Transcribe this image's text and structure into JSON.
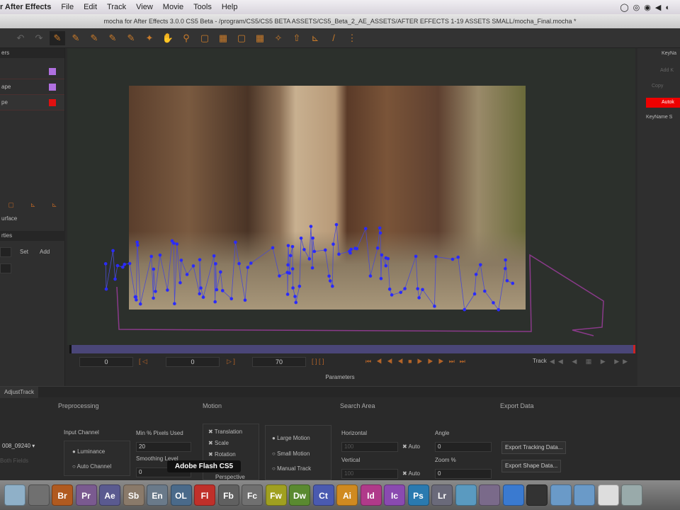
{
  "menubar": {
    "app": "r After Effects",
    "items": [
      "File",
      "Edit",
      "Track",
      "View",
      "Movie",
      "Tools",
      "Help"
    ]
  },
  "window": {
    "title": "mocha for After Effects 3.0.0 CS5 Beta - /program/CS5/CS5 BETA ASSETS/CS5_Beta_2_AE_ASSETS/AFTER EFFECTS 1-19 ASSETS SMALL/mocha_Final.mocha *"
  },
  "layers": {
    "header": "ers",
    "items": [
      {
        "label": "",
        "color": "#b070e0"
      },
      {
        "label": "ape",
        "color": "#b070e0"
      },
      {
        "label": "pe",
        "color": "#e01010"
      }
    ],
    "surface": "urface"
  },
  "clip_panel": {
    "header": "rties",
    "set": "Set",
    "add": "Add"
  },
  "right_panel": {
    "keyframe": "KeyNa",
    "add_key": "Add K",
    "copy": "Copy",
    "auto": "Autok",
    "keyname": "KeyName S"
  },
  "transport": {
    "in": "0",
    "current": "0",
    "out": "70",
    "track_label": "Track"
  },
  "parameters_label": "Parameters",
  "tab": "AdjustTrack",
  "sections": {
    "preprocessing": "Preprocessing",
    "motion": "Motion",
    "search": "Search Area",
    "export": "Export Data"
  },
  "preprocessing": {
    "clip": "008_09240",
    "clip_sub": "Both Fields",
    "input_channel": "Input Channel",
    "luminance": "Luminance",
    "auto_channel": "Auto Channel",
    "min_pixels": "Min % Pixels Used",
    "min_pixels_value": "20",
    "smoothing": "Smoothing Level",
    "smoothing_value": "0"
  },
  "motion": {
    "translation": "Translation",
    "scale": "Scale",
    "rotation": "Rotation",
    "perspective": "Perspective",
    "large": "Large Motion",
    "small": "Small Motion",
    "manual": "Manual Track"
  },
  "search": {
    "horizontal": "Horizontal",
    "h_value": "100",
    "vertical": "Vertical",
    "v_value": "100",
    "auto": "Auto",
    "angle": "Angle",
    "angle_value": "0",
    "zoom": "Zoom %",
    "zoom_value": "0"
  },
  "export": {
    "tracking": "Export Tracking Data...",
    "shape": "Export Shape Data..."
  },
  "tooltip": "Adobe Flash CS5",
  "dock": [
    {
      "label": "",
      "color": "#8fb0c8"
    },
    {
      "label": "",
      "color": "#707070"
    },
    {
      "label": "Br",
      "color": "#b05a20"
    },
    {
      "label": "Pr",
      "color": "#7a5a90"
    },
    {
      "label": "Ae",
      "color": "#5a5a90"
    },
    {
      "label": "Sb",
      "color": "#8a7a6a"
    },
    {
      "label": "En",
      "color": "#6a7a8a"
    },
    {
      "label": "OL",
      "color": "#4a6a8a"
    },
    {
      "label": "Fl",
      "color": "#c0302a"
    },
    {
      "label": "Fb",
      "color": "#606060"
    },
    {
      "label": "Fc",
      "color": "#707070"
    },
    {
      "label": "Fw",
      "color": "#a0a020"
    },
    {
      "label": "Dw",
      "color": "#5a8a30"
    },
    {
      "label": "Ct",
      "color": "#4a5ab0"
    },
    {
      "label": "Ai",
      "color": "#d08a20"
    },
    {
      "label": "Id",
      "color": "#b03a8a"
    },
    {
      "label": "Ic",
      "color": "#8a4ab0"
    },
    {
      "label": "Ps",
      "color": "#2a7ab0"
    },
    {
      "label": "Lr",
      "color": "#6a6a7a"
    },
    {
      "label": "",
      "color": "#5a9ac0"
    },
    {
      "label": "",
      "color": "#7a6a8a"
    },
    {
      "label": "",
      "color": "#3a7ad0"
    },
    {
      "label": "",
      "color": "#333"
    },
    {
      "label": "",
      "color": "#6a9ac8"
    },
    {
      "label": "",
      "color": "#6a9ac8"
    },
    {
      "label": "",
      "color": "#ddd"
    },
    {
      "label": "",
      "color": "#9aa"
    }
  ]
}
